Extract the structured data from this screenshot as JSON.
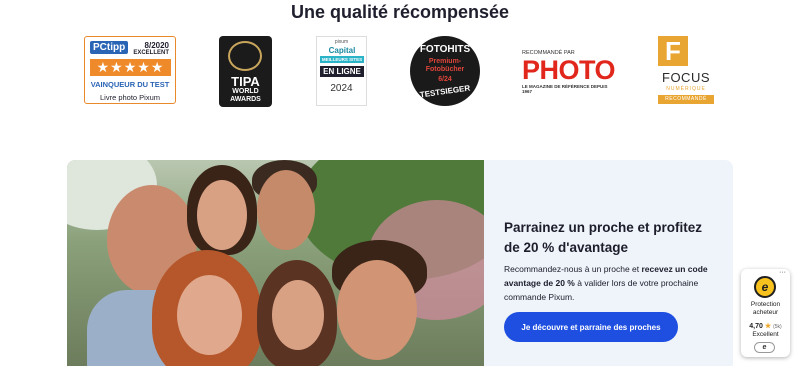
{
  "heading": "Une qualité récompensée",
  "awards": {
    "pctipp": {
      "logo": "PCtipp",
      "date": "8/2020",
      "grade": "EXCELLENT",
      "stars": "★★★★★",
      "winner": "VAINQUEUR DU TEST",
      "product": "Livre photo Pixum"
    },
    "tipa": {
      "title": "TIPA",
      "subtitle_1": "WORLD",
      "subtitle_2": "AWARDS"
    },
    "capital": {
      "brand": "pixum",
      "magazine": "Capital",
      "ribbon": "MEILLEURS SITES",
      "label": "EN LIGNE",
      "year": "2024"
    },
    "fotohits": {
      "title": "FOTOHITS",
      "category": "Premium-Fotobücher",
      "issue": "6/24",
      "badge": "TESTSIEGER"
    },
    "photo_mag": {
      "recommended": "RECOMMANDÉ PAR",
      "title": "PHOTO",
      "tagline": "LE MAGAZINE DE RÉFÉRENCE DEPUIS 1967"
    },
    "focus": {
      "letter": "F",
      "title": "FOCUS",
      "subtitle": "NUMÉRIQUE",
      "badge": "RECOMMANDÉ"
    }
  },
  "referral": {
    "title": "Parrainez un proche et profitez de 20 % d'avantage",
    "text_1": "Recommandez-nous à un proche et ",
    "text_bold": "recevez un code avantage de 20 %",
    "text_2": " à valider lors de votre prochaine commande Pixum.",
    "cta_label": "Je découvre et parraine des proches"
  },
  "trusted_shops": {
    "menu": "···",
    "seal_letter": "e",
    "protection_line_1": "Protection",
    "protection_line_2": "acheteur",
    "rating": "4,70",
    "star": "★",
    "rating_count": "(5k)",
    "level": "Excellent",
    "mini_seal": "e"
  },
  "colors": {
    "accent_blue": "#1f4fe0",
    "card_bg": "#eef4fa",
    "pctipp_orange": "#ef8a2a",
    "photo_red": "#e1261c",
    "focus_gold": "#e9a531"
  }
}
